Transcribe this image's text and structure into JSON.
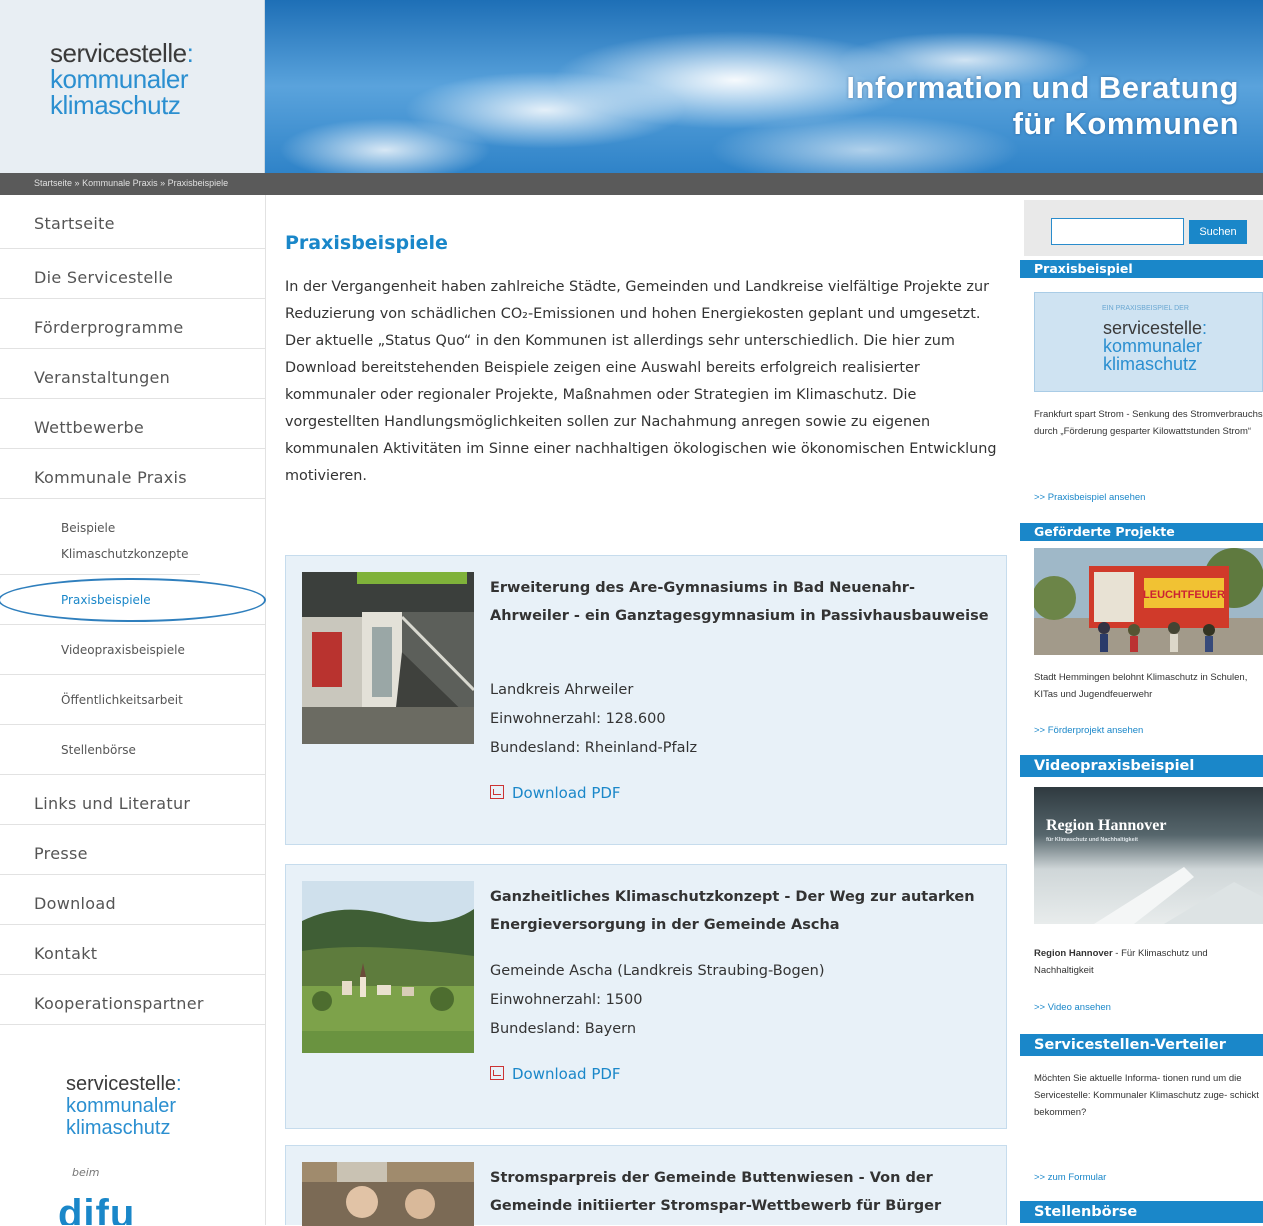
{
  "header": {
    "logo_line1": "servicestelle",
    "logo_colon": ":",
    "logo_line2": "kommunaler",
    "logo_line3": "klimaschutz",
    "tagline_line1": "Information und Beratung",
    "tagline_line2": "für Kommunen"
  },
  "breadcrumb": {
    "items": [
      "Startseite",
      "Kommunale Praxis",
      "Praxisbeispiele"
    ],
    "separator": "»"
  },
  "nav": {
    "items": [
      {
        "label": "Startseite"
      },
      {
        "label": "Die Servicestelle"
      },
      {
        "label": "Förderprogramme"
      },
      {
        "label": "Veranstaltungen"
      },
      {
        "label": "Wettbewerbe"
      },
      {
        "label": "Kommunale Praxis"
      }
    ],
    "sub_items": [
      {
        "label": "Beispiele Klimaschutzkonzepte"
      },
      {
        "label": "Praxisbeispiele"
      },
      {
        "label": "Videopraxisbeispiele"
      },
      {
        "label": "Öffentlichkeitsarbeit"
      },
      {
        "label": "Stellenbörse"
      }
    ],
    "items_after": [
      {
        "label": "Links und Literatur"
      },
      {
        "label": "Presse"
      },
      {
        "label": "Download"
      },
      {
        "label": "Kontakt"
      },
      {
        "label": "Kooperationspartner"
      }
    ],
    "footer_logo": {
      "line1": "servicestelle",
      "colon": ":",
      "line2": "kommunaler",
      "line3": "klimaschutz",
      "beim": "beim",
      "partner": "difu"
    }
  },
  "main": {
    "title": "Praxisbeispiele",
    "intro": "In der Vergangenheit haben zahlreiche Städte, Gemeinden und Landkreise vielfältige Projekte zur Reduzierung von schädlichen CO₂-Emissionen und hohen Energiekosten geplant und umgesetzt. Der aktuelle „Status Quo“ in den Kommunen ist allerdings sehr unterschiedlich. Die hier zum Download bereitstehenden Beispiele zeigen eine Auswahl bereits erfolgreich realisierter kommunaler oder regionaler Projekte, Maßnahmen oder Strategien im Klimaschutz. Die vorgestellten Handlungsmöglichkeiten sollen zur Nachahmung anregen sowie zu eigenen kommunalen Aktivitäten im Sinne einer nachhaltigen ökologischen wie ökonomischen Entwicklung motivieren.",
    "cards": [
      {
        "title": "Erweiterung des Are-Gymnasiums in Bad Neuenahr-Ahrweiler - ein Ganztagesgymnasium in Passivhausbauweise",
        "location": "Landkreis Ahrweiler",
        "population": "Einwohnerzahl: 128.600",
        "state": "Bundesland: Rheinland-Pfalz",
        "download": "Download PDF"
      },
      {
        "title": "Ganzheitliches Klimaschutzkonzept - Der Weg zur autarken Energieversorgung in der Gemeinde Ascha",
        "location": "Gemeinde Ascha (Landkreis Straubing-Bogen)",
        "population": "Einwohnerzahl: 1500",
        "state": "Bundesland: Bayern",
        "download": "Download PDF"
      },
      {
        "title": "Stromsparpreis der Gemeinde Buttenwiesen - Von der Gemeinde initiierter Stromspar-Wettbewerb für Bürger"
      }
    ]
  },
  "sidebar": {
    "search_button": "Suchen",
    "search_value": "",
    "praxisbeispiel": {
      "heading": "Praxisbeispiel",
      "badge_small": "EIN PRAXISBEISPIEL DER",
      "badge_line1": "servicestelle",
      "badge_colon": ":",
      "badge_line2": "kommunaler",
      "badge_line3": "klimaschutz",
      "text": "Frankfurt spart Strom - Senkung des Stromverbrauchs durch „Förderung gesparter Kilowattstunden Strom“",
      "link": ">> Praxisbeispiel ansehen"
    },
    "gefoerderte": {
      "heading": "Geförderte Projekte",
      "image_sign": "LEUCHTFEUER",
      "text": "Stadt Hemmingen belohnt Klimaschutz in Schulen, KITas und Jugendfeuerwehr",
      "link": ">> Förderprojekt ansehen"
    },
    "video": {
      "heading": "Videopraxisbeispiel",
      "image_title": "Region Hannover",
      "image_subtitle": "für Klimaschutz und Nachhaltigkeit",
      "text_bold": "Region Hannover",
      "text_rest": " - Für Klimaschutz und Nachhaltigkeit",
      "link": ">> Video ansehen"
    },
    "verteiler": {
      "heading": "Servicestellen-Verteiler",
      "text": "Möchten Sie aktuelle Informa- tionen rund um die Servicestelle: Kommunaler Klimaschutz zuge- schickt bekommen?",
      "link": ">> zum Formular"
    },
    "stellen": {
      "heading": "Stellenbörse"
    }
  }
}
